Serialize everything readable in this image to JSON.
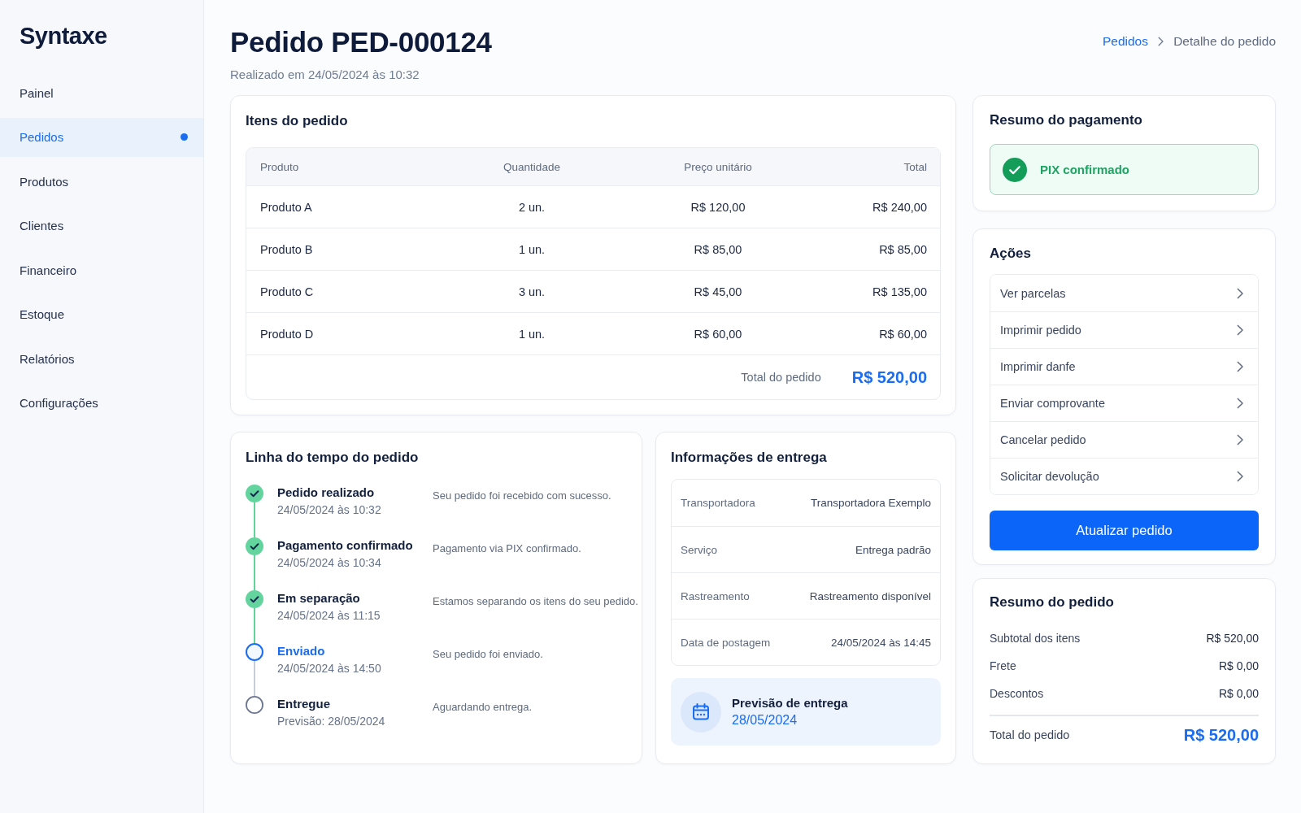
{
  "sidebar": {
    "logo": "Syntaxe",
    "items": [
      {
        "label": "Painel",
        "selected": false
      },
      {
        "label": "Pedidos",
        "selected": true
      },
      {
        "label": "Produtos",
        "selected": false
      },
      {
        "label": "Clientes",
        "selected": false
      },
      {
        "label": "Financeiro",
        "selected": false
      },
      {
        "label": "Estoque",
        "selected": false
      },
      {
        "label": "Relatórios",
        "selected": false
      },
      {
        "label": "Configurações",
        "selected": false
      }
    ]
  },
  "header": {
    "title": "Pedido PED-000124",
    "subtitle": "Realizado em 24/05/2024 às 10:32",
    "breadcrumb": [
      {
        "label": "Pedidos",
        "kind": "link"
      },
      {
        "label": "Detalhe do pedido",
        "kind": "current"
      }
    ]
  },
  "order_items": {
    "title": "Itens do pedido",
    "columns": [
      "Produto",
      "Quantidade",
      "Preço unitário",
      "Total"
    ],
    "rows": [
      [
        "Produto A",
        "2 un.",
        "R$ 120,00",
        "R$ 240,00"
      ],
      [
        "Produto B",
        "1 un.",
        "R$ 85,00",
        "R$ 85,00"
      ],
      [
        "Produto C",
        "3 un.",
        "R$ 45,00",
        "R$ 135,00"
      ],
      [
        "Produto D",
        "1 un.",
        "R$ 60,00",
        "R$ 60,00"
      ]
    ],
    "total": {
      "label": "Total do pedido",
      "value": "R$ 520,00"
    }
  },
  "timeline": {
    "title": "Linha do tempo do pedido",
    "steps": [
      {
        "kind": "done",
        "title": "Pedido realizado",
        "date": "24/05/2024 às 10:32",
        "description": "Seu pedido foi recebido com sucesso."
      },
      {
        "kind": "done",
        "title": "Pagamento confirmado",
        "date": "24/05/2024 às 10:34",
        "description": "Pagamento via PIX confirmado."
      },
      {
        "kind": "done",
        "title": "Em separação",
        "date": "24/05/2024 às 11:15",
        "description": "Estamos separando os itens do seu pedido."
      },
      {
        "kind": "current",
        "title": "Enviado",
        "date": "24/05/2024 às 14:50",
        "description": "Seu pedido foi enviado."
      },
      {
        "kind": "pending",
        "title": "Entregue",
        "date": "Previsão: 28/05/2024",
        "description": "Aguardando entrega."
      }
    ]
  },
  "delivery": {
    "title": "Informações de entrega",
    "rows": [
      {
        "label": "Transportadora",
        "value": "Transportadora Exemplo"
      },
      {
        "label": "Serviço",
        "value": "Entrega padrão"
      },
      {
        "label": "Rastreamento",
        "value": "Rastreamento disponível"
      },
      {
        "label": "Data de postagem",
        "value": "24/05/2024 às 14:45"
      }
    ],
    "forecast": {
      "label": "Previsão de entrega",
      "date": "28/05/2024"
    }
  },
  "payment": {
    "title": "Resumo do pagamento",
    "status": {
      "label": "PIX confirmado",
      "confirmed": true
    }
  },
  "actions": {
    "title": "Ações",
    "items": [
      "Ver parcelas",
      "Imprimir pedido",
      "Imprimir danfe",
      "Enviar comprovante",
      "Cancelar pedido",
      "Solicitar devolução"
    ],
    "button": "Atualizar pedido"
  },
  "order_summary": {
    "title": "Resumo do pedido",
    "rows": [
      {
        "label": "Subtotal dos itens",
        "value": "R$ 520,00"
      },
      {
        "label": "Frete",
        "value": "R$ 0,00"
      },
      {
        "label": "Descontos",
        "value": "R$ 0,00"
      }
    ],
    "total": {
      "label": "Total do pedido",
      "value": "R$ 520,00"
    }
  }
}
